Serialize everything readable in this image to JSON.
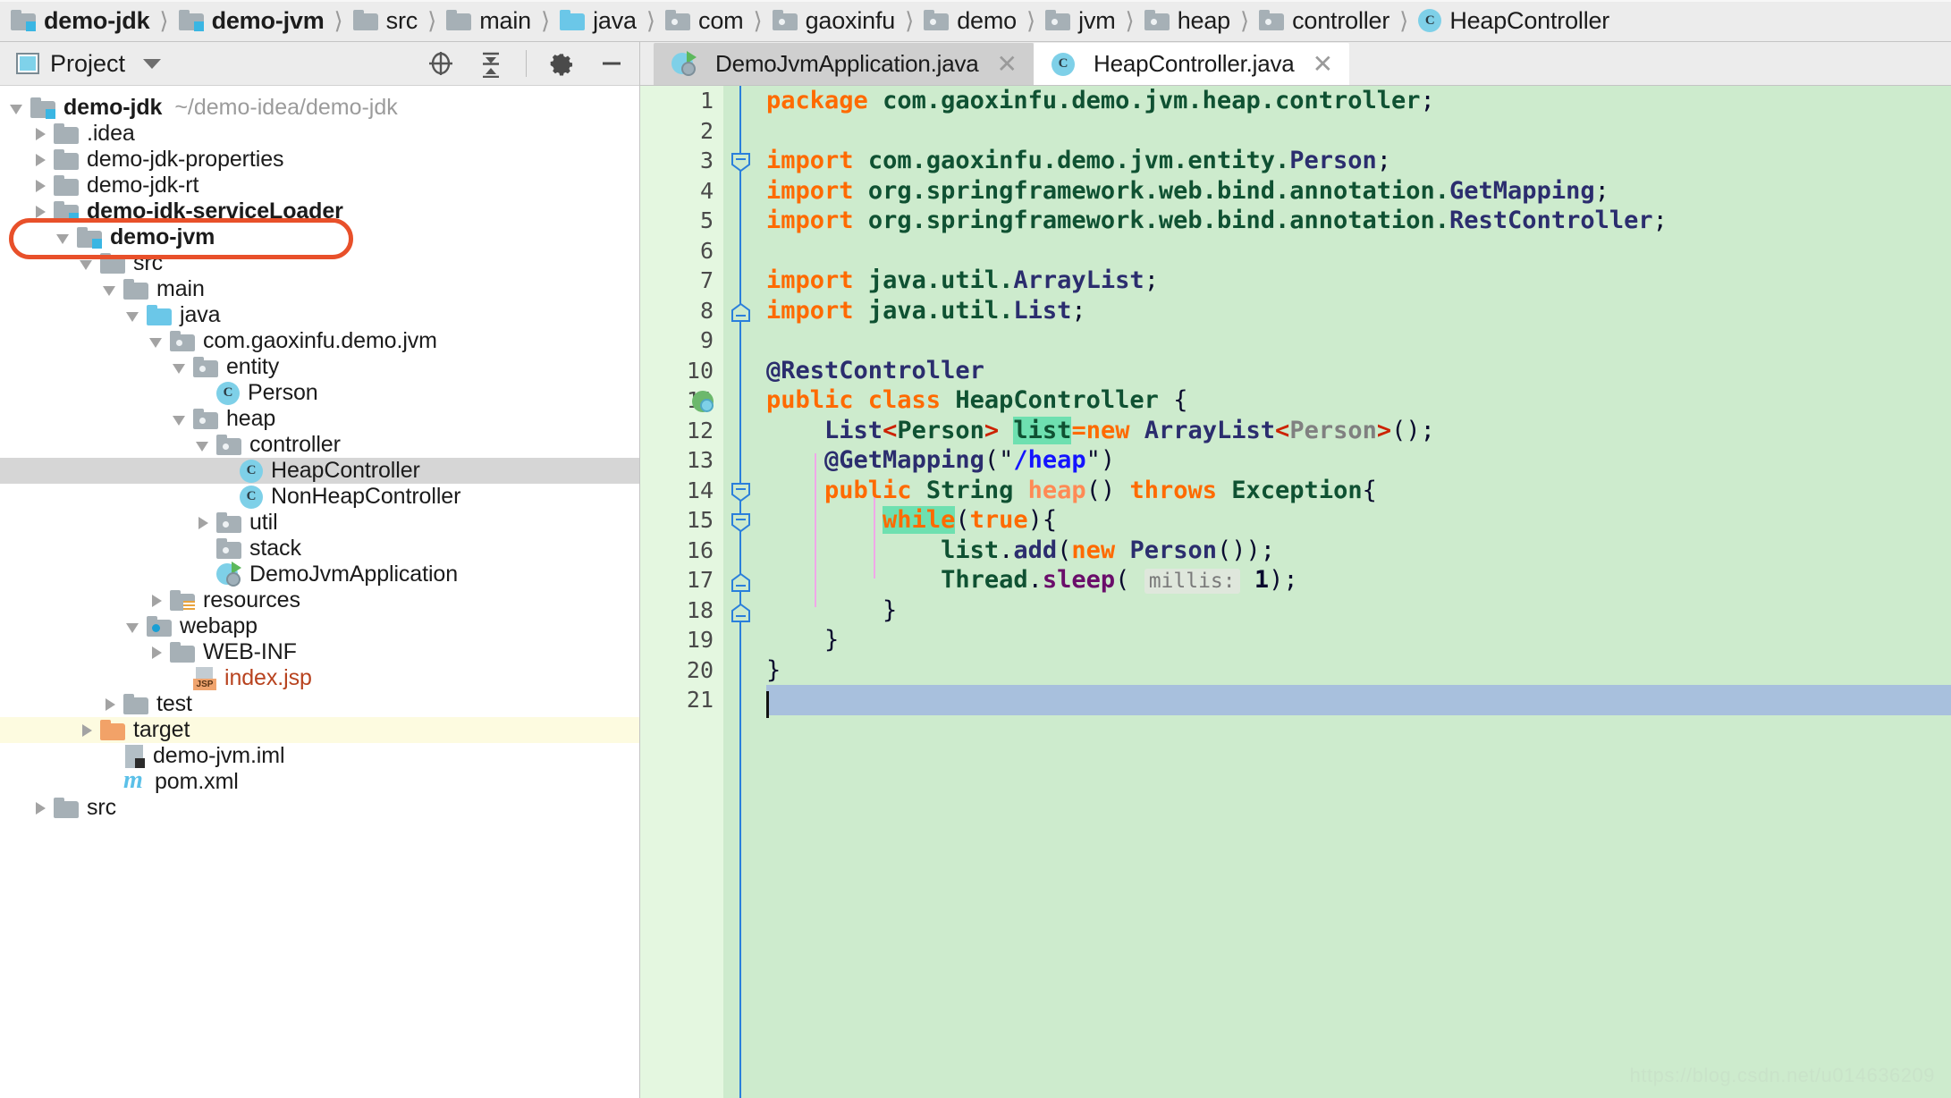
{
  "breadcrumb": {
    "items": [
      {
        "label": "demo-jdk",
        "icon": "module-folder-icon",
        "bold": true
      },
      {
        "label": "demo-jvm",
        "icon": "module-folder-icon",
        "bold": true
      },
      {
        "label": "src",
        "icon": "folder-icon",
        "bold": false
      },
      {
        "label": "main",
        "icon": "folder-icon",
        "bold": false
      },
      {
        "label": "java",
        "icon": "source-folder-icon",
        "bold": false
      },
      {
        "label": "com",
        "icon": "package-icon",
        "bold": false
      },
      {
        "label": "gaoxinfu",
        "icon": "package-icon",
        "bold": false
      },
      {
        "label": "demo",
        "icon": "package-icon",
        "bold": false
      },
      {
        "label": "jvm",
        "icon": "package-icon",
        "bold": false
      },
      {
        "label": "heap",
        "icon": "package-icon",
        "bold": false
      },
      {
        "label": "controller",
        "icon": "package-icon",
        "bold": false
      },
      {
        "label": "HeapController",
        "icon": "class-icon",
        "bold": false
      }
    ],
    "separator": "〉"
  },
  "sidebar": {
    "toolbar": {
      "title": "Project",
      "dropdown_icon": "chevron-down-icon",
      "locate_icon": "locate-target-icon",
      "collapse_icon": "collapse-all-icon",
      "settings_icon": "gear-icon",
      "hide_icon": "minimize-icon"
    },
    "tree": [
      {
        "label": "demo-jdk",
        "suffix": "~/demo-idea/demo-jdk",
        "indent": 0,
        "arrow": "down",
        "icon": "module-folder-icon",
        "bold": true
      },
      {
        "label": ".idea",
        "indent": 1,
        "arrow": "right",
        "icon": "folder-icon",
        "bold": false
      },
      {
        "label": "demo-jdk-properties",
        "indent": 1,
        "arrow": "right",
        "icon": "folder-icon",
        "bold": false
      },
      {
        "label": "demo-jdk-rt",
        "indent": 1,
        "arrow": "right",
        "icon": "folder-icon",
        "bold": false
      },
      {
        "label": "demo-jdk-serviceLoader",
        "indent": 1,
        "arrow": "right",
        "icon": "module-folder-icon",
        "bold": true
      },
      {
        "label": "demo-jvm",
        "indent": 1,
        "arrow": "down",
        "icon": "module-folder-icon",
        "bold": true,
        "annotated": true
      },
      {
        "label": "src",
        "indent": 2,
        "arrow": "down",
        "icon": "folder-icon",
        "bold": false
      },
      {
        "label": "main",
        "indent": 3,
        "arrow": "down",
        "icon": "folder-icon",
        "bold": false
      },
      {
        "label": "java",
        "indent": 4,
        "arrow": "down",
        "icon": "source-folder-icon",
        "bold": false
      },
      {
        "label": "com.gaoxinfu.demo.jvm",
        "indent": 5,
        "arrow": "down",
        "icon": "package-icon",
        "bold": false
      },
      {
        "label": "entity",
        "indent": 6,
        "arrow": "down",
        "icon": "package-icon",
        "bold": false
      },
      {
        "label": "Person",
        "indent": 7,
        "arrow": "none",
        "icon": "class-icon",
        "bold": false
      },
      {
        "label": "heap",
        "indent": 6,
        "arrow": "down",
        "icon": "package-icon",
        "bold": false
      },
      {
        "label": "controller",
        "indent": 7,
        "arrow": "down",
        "icon": "package-icon",
        "bold": false
      },
      {
        "label": "HeapController",
        "indent": 8,
        "arrow": "none",
        "icon": "class-icon",
        "bold": false,
        "selected": true
      },
      {
        "label": "NonHeapController",
        "indent": 8,
        "arrow": "none",
        "icon": "class-icon",
        "bold": false
      },
      {
        "label": "util",
        "indent": 7,
        "arrow": "right",
        "icon": "package-icon",
        "bold": false
      },
      {
        "label": "stack",
        "indent": 7,
        "arrow": "none",
        "icon": "package-icon",
        "bold": false
      },
      {
        "label": "DemoJvmApplication",
        "indent": 7,
        "arrow": "none",
        "icon": "spring-boot-class-icon",
        "bold": false
      },
      {
        "label": "resources",
        "indent": 5,
        "arrow": "right",
        "icon": "resources-folder-icon",
        "bold": false
      },
      {
        "label": "webapp",
        "indent": 5,
        "arrow": "down",
        "icon": "webapp-folder-icon",
        "bold": false
      },
      {
        "label": "WEB-INF",
        "indent": 6,
        "arrow": "right",
        "icon": "folder-icon",
        "bold": false
      },
      {
        "label": "index.jsp",
        "indent": 6,
        "arrow": "none",
        "icon": "jsp-file-icon",
        "bold": false,
        "style": "jsp"
      },
      {
        "label": "test",
        "indent": 3,
        "arrow": "right",
        "icon": "folder-icon",
        "bold": false
      },
      {
        "label": "target",
        "indent": 2,
        "arrow": "right",
        "icon": "excluded-folder-icon",
        "bold": false,
        "excluded": true
      },
      {
        "label": "demo-jvm.iml",
        "indent": 2,
        "arrow": "none",
        "icon": "iml-file-icon",
        "bold": false
      },
      {
        "label": "pom.xml",
        "indent": 2,
        "arrow": "none",
        "icon": "maven-file-icon",
        "bold": false
      },
      {
        "label": "src",
        "indent": 1,
        "arrow": "right",
        "icon": "folder-icon",
        "bold": false
      }
    ]
  },
  "editor": {
    "tabs": [
      {
        "label": "DemoJvmApplication.java",
        "icon": "spring-boot-class-icon",
        "active": false,
        "close_icon": "close-icon"
      },
      {
        "label": "HeapController.java",
        "icon": "class-icon",
        "active": true,
        "close_icon": "close-icon"
      }
    ],
    "current_line": 21,
    "line_numbers": [
      1,
      2,
      3,
      4,
      5,
      6,
      7,
      8,
      9,
      10,
      11,
      12,
      13,
      14,
      15,
      16,
      17,
      18,
      19,
      20,
      21
    ],
    "code_lines": [
      "package com.gaoxinfu.demo.jvm.heap.controller;",
      "",
      "import com.gaoxinfu.demo.jvm.entity.Person;",
      "import org.springframework.web.bind.annotation.GetMapping;",
      "import org.springframework.web.bind.annotation.RestController;",
      "",
      "import java.util.ArrayList;",
      "import java.util.List;",
      "",
      "@RestController",
      "public class HeapController {",
      "    List<Person> list=new ArrayList<Person>();",
      "    @GetMapping(\"/heap\")",
      "    public String heap() throws Exception{",
      "        while(true){",
      "            list.add(new Person());",
      "            Thread.sleep( millis: 1);",
      "        }",
      "    }",
      "}",
      ""
    ],
    "inlay_hint": "millis:",
    "gutter_marker_line": 11,
    "gutter_marker_icon": "spring-bean-icon",
    "fold_markers": [
      3,
      8,
      14,
      15,
      18,
      19
    ],
    "watermark": "https://blog.csdn.net/u014636209"
  },
  "colors": {
    "editor_background": "#cdebcd",
    "gutter_background": "#e4f7e0",
    "keyword": "#ff6a00",
    "identifier": "#0f5132",
    "class_name": "#2b2d6e",
    "string": "#1414ff",
    "method": "#6a0d6a",
    "current_line": "#a8c0dd",
    "field_highlight": "#6ee0b0",
    "annotation_box": "#e8502a",
    "selection": "#d6d6d6",
    "excluded_row": "#fdfbe0",
    "chrome": "#ececec"
  }
}
